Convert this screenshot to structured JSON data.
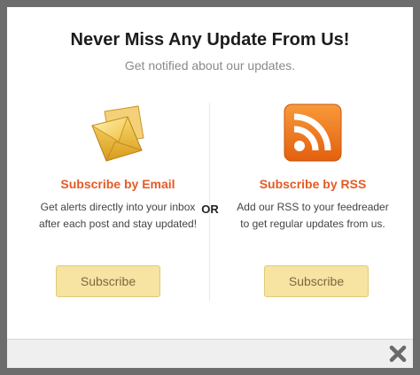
{
  "modal": {
    "title": "Never Miss Any Update From Us!",
    "subtitle": "Get notified about our updates.",
    "separator": "OR",
    "email": {
      "icon": "envelope-icon",
      "title": "Subscribe by Email",
      "description": "Get alerts directly into your inbox after each post and stay updated!",
      "button_label": "Subscribe"
    },
    "rss": {
      "icon": "rss-icon",
      "title": "Subscribe by RSS",
      "description": "Add our RSS to your feedreader to get regular updates from us.",
      "button_label": "Subscribe"
    },
    "close_icon": "close-icon"
  },
  "colors": {
    "accent": "#e35b26",
    "button_bg": "#f7e3a2",
    "rss_orange": "#f07d1a",
    "overlay": "#6d6d6d"
  }
}
